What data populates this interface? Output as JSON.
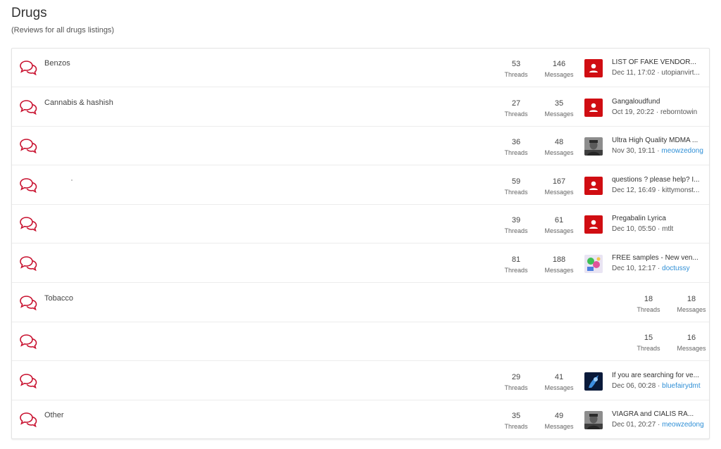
{
  "header": {
    "title": "Drugs",
    "subtitle": "(Reviews for all drugs listings)"
  },
  "colors": {
    "accent": "#d00d12",
    "link": "#2f8fd6"
  },
  "forums": [
    {
      "name": "Benzos",
      "threads": "53",
      "threads_label": "Threads",
      "messages": "146",
      "messages_label": "Messages",
      "avatar": "red-user",
      "last_title": "LIST OF FAKE VENDOR...",
      "last_date": "Dec 11, 17:02 · ",
      "last_user": "utopianvirt..."
    },
    {
      "name": "Cannabis & hashish",
      "threads": "27",
      "threads_label": "Threads",
      "messages": "35",
      "messages_label": "Messages",
      "avatar": "red-user",
      "last_title": "Gangaloudfund",
      "last_date": "Oct 19, 20:22 · ",
      "last_user": "reborntowin"
    },
    {
      "name": "",
      "threads": "36",
      "threads_label": "Threads",
      "messages": "48",
      "messages_label": "Messages",
      "avatar": "photo-portrait",
      "last_title": "Ultra High Quality MDMA ...",
      "last_date": "Nov 30, 19:11 · ",
      "last_user": "meowzedong"
    },
    {
      "name": "",
      "threads": "59",
      "threads_label": "Threads",
      "messages": "167",
      "messages_label": "Messages",
      "avatar": "red-user",
      "last_title": "questions ? please help? I...",
      "last_date": "Dec 12, 16:49 · ",
      "last_user": "kittymonst..."
    },
    {
      "name": "",
      "threads": "39",
      "threads_label": "Threads",
      "messages": "61",
      "messages_label": "Messages",
      "avatar": "red-user",
      "last_title": "Pregabalin Lyrica",
      "last_date": "Dec 10, 05:50 · ",
      "last_user": "mtlt"
    },
    {
      "name": "",
      "threads": "81",
      "threads_label": "Threads",
      "messages": "188",
      "messages_label": "Messages",
      "avatar": "photo-cartoon",
      "last_title": "FREE samples - New ven...",
      "last_date": "Dec 10, 12:17 · ",
      "last_user": "doctussy"
    },
    {
      "name": "Tobacco",
      "threads": "18",
      "threads_label": "Threads",
      "messages": "18",
      "messages_label": "Messages"
    },
    {
      "name": "",
      "threads": "15",
      "threads_label": "Threads",
      "messages": "16",
      "messages_label": "Messages"
    },
    {
      "name": "",
      "threads": "29",
      "threads_label": "Threads",
      "messages": "41",
      "messages_label": "Messages",
      "avatar": "photo-blue",
      "last_title": "If you are searching for ve...",
      "last_date": "Dec 06, 00:28 · ",
      "last_user": "bluefairydmt"
    },
    {
      "name": "Other",
      "threads": "35",
      "threads_label": "Threads",
      "messages": "49",
      "messages_label": "Messages",
      "avatar": "photo-portrait",
      "last_title": "VIAGRA and CIALIS RA...",
      "last_date": "Dec 01, 20:27 · ",
      "last_user": "meowzedong"
    }
  ]
}
